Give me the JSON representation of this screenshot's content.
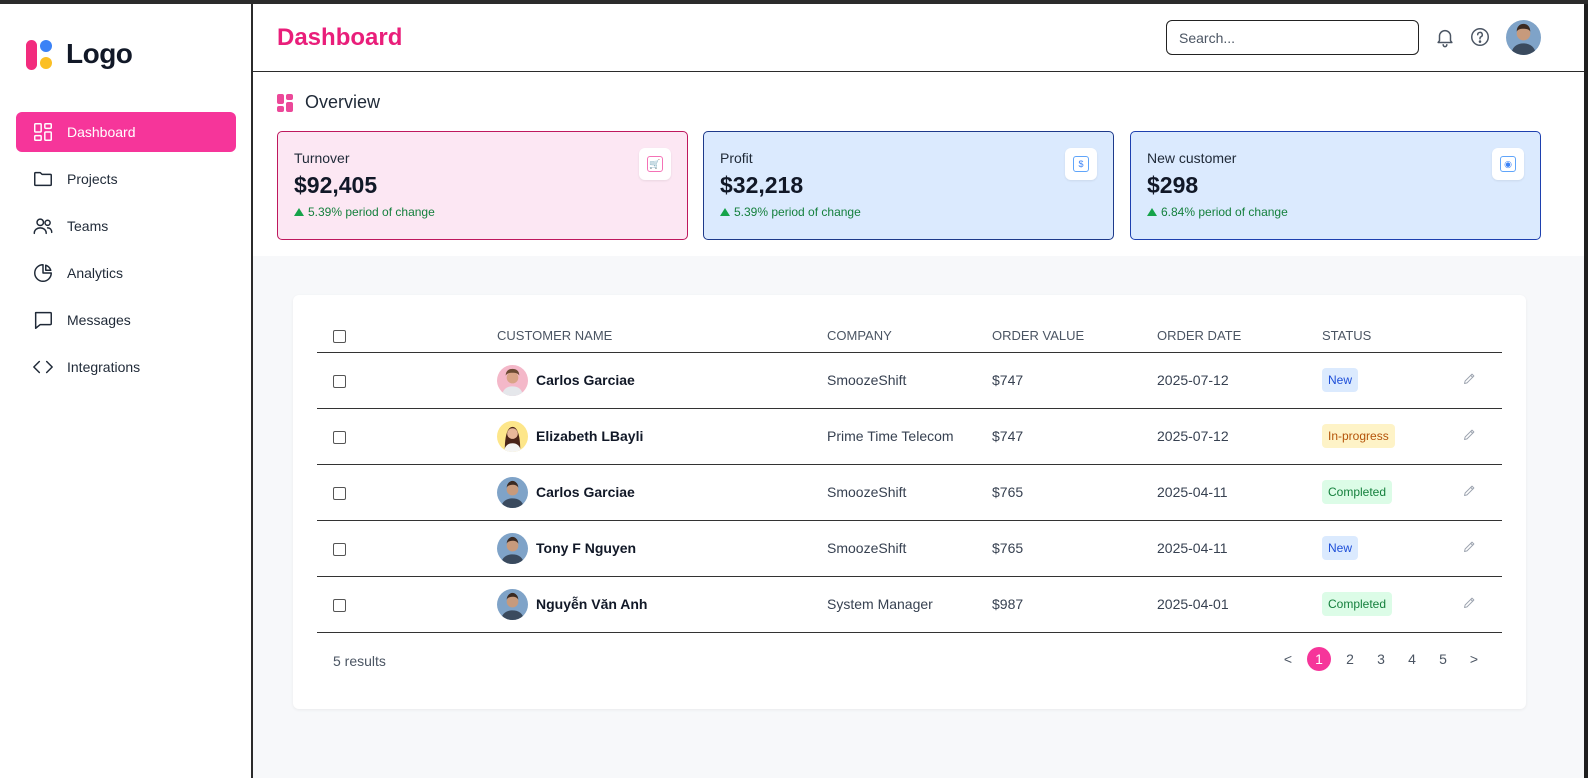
{
  "app": {
    "logo_text": "Logo"
  },
  "sidebar": {
    "items": [
      {
        "label": "Dashboard",
        "icon": "dashboard-icon",
        "active": true
      },
      {
        "label": "Projects",
        "icon": "folder-icon"
      },
      {
        "label": "Teams",
        "icon": "users-icon"
      },
      {
        "label": "Analytics",
        "icon": "pie-chart-icon"
      },
      {
        "label": "Messages",
        "icon": "message-icon"
      },
      {
        "label": "Integrations",
        "icon": "code-icon"
      }
    ]
  },
  "header": {
    "title": "Dashboard",
    "search_placeholder": "Search..."
  },
  "overview": {
    "title": "Overview",
    "cards": [
      {
        "label": "Turnover",
        "value": "$92,405",
        "change": "5.39% period of change",
        "icon": "cart-icon"
      },
      {
        "label": "Profit",
        "value": "$32,218",
        "change": "5.39% period of change",
        "icon": "dollar-icon"
      },
      {
        "label": "New customer",
        "value": "$298",
        "change": "6.84% period of change",
        "icon": "target-icon"
      }
    ]
  },
  "table": {
    "headers": [
      "CUSTOMER NAME",
      "COMPANY",
      "ORDER VALUE",
      "ORDER DATE",
      "STATUS"
    ],
    "rows": [
      {
        "name": "Carlos Garciae",
        "company": "SmoozeShift",
        "value": "$747",
        "date": "2025-07-12",
        "status": "New"
      },
      {
        "name": "Elizabeth LBayli",
        "company": "Prime Time Telecom",
        "value": "$747",
        "date": "2025-07-12",
        "status": "In-progress"
      },
      {
        "name": "Carlos Garciae",
        "company": "SmoozeShift",
        "value": "$765",
        "date": "2025-04-11",
        "status": "Completed"
      },
      {
        "name": "Tony F Nguyen",
        "company": "SmoozeShift",
        "value": "$765",
        "date": "2025-04-11",
        "status": "New"
      },
      {
        "name": "Nguyễn Văn Anh",
        "company": "System Manager",
        "value": "$987",
        "date": "2025-04-01",
        "status": "Completed"
      }
    ],
    "results_text": "5 results",
    "pagination": {
      "prev": "<",
      "pages": [
        "1",
        "2",
        "3",
        "4",
        "5"
      ],
      "next": ">",
      "current": "1"
    }
  },
  "colors": {
    "accent": "#f6359a",
    "title": "#e91e7a",
    "status_new": "#dbeafe",
    "status_progress": "#fef3c7",
    "status_done": "#dcfce7"
  }
}
